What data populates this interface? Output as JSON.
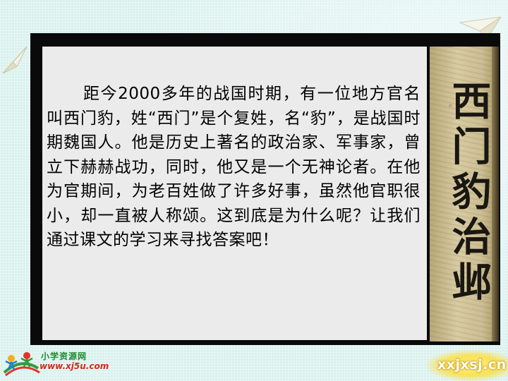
{
  "slide": {
    "passage": "距今2000多年的战国时期，有一位地方官名叫西门豹，姓“西门”是个复姓，名“豹”，是战国时期魏国人。他是历史上著名的政治家、军事家，曾立下赫赫战功，同时，他又是一个无神论者。在他为官期间，为老百姓做了许多好事，虽然他官职很小，却一直被人称颂。这到底是为什么呢？让我们通过课文的学习来寻找答案吧！",
    "cover_title": "西门豹治邺"
  },
  "footer": {
    "logo_name": "小学资源网",
    "logo_url": "www.xj5u.com",
    "watermark": "xxjxsj.cn"
  },
  "icons": [
    "paper-plane-icon",
    "children-logo-icon"
  ],
  "colors": {
    "background": "#d9f1ee",
    "frame": "#0a0a0a",
    "panel": "#ebebeb",
    "logo_green": "#1f8a2c",
    "logo_red": "#d42a1a"
  }
}
